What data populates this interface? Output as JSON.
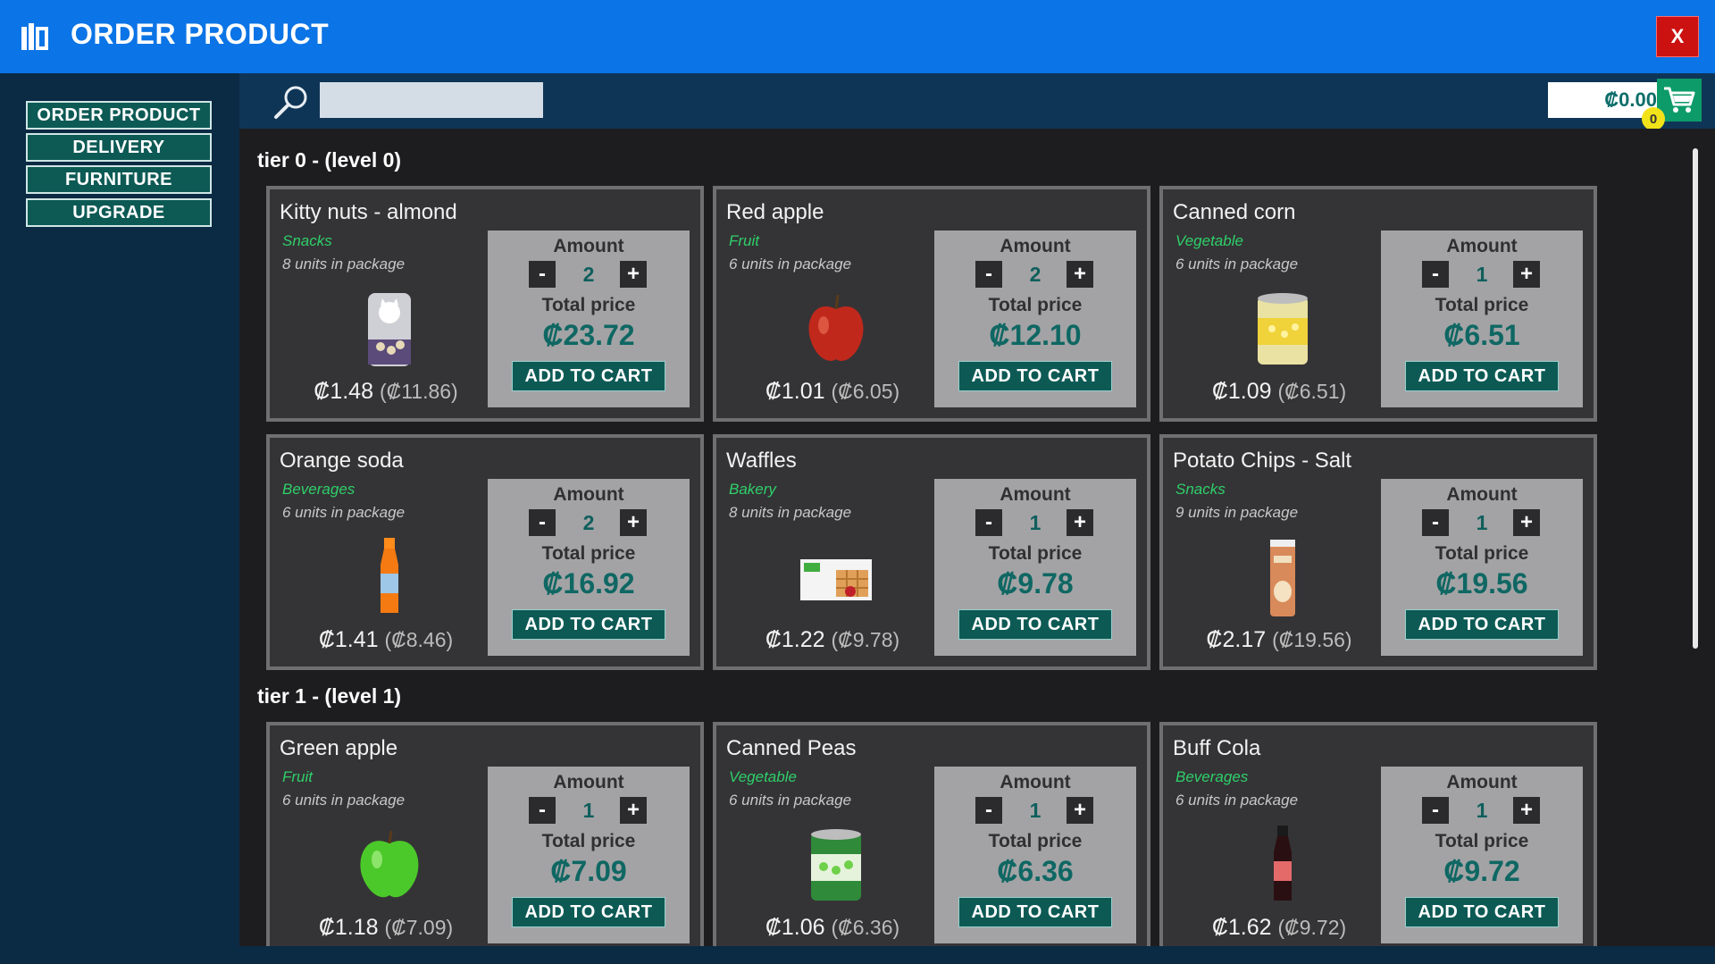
{
  "window": {
    "title": "ORDER PRODUCT",
    "close_label": "X"
  },
  "sidebar": {
    "items": [
      {
        "label": "ORDER PRODUCT"
      },
      {
        "label": "DELIVERY"
      },
      {
        "label": "FURNITURE"
      },
      {
        "label": "UPGRADE"
      }
    ]
  },
  "search": {
    "value": "",
    "placeholder": ""
  },
  "cart": {
    "total": "₡0.00",
    "count": "0"
  },
  "tiers": [
    {
      "title": "tier 0 - (level 0)",
      "products": [
        {
          "name": "Kitty nuts - almond",
          "category": "Snacks",
          "units": "8 units in package",
          "unit_price": "₡1.48",
          "pkg_price": "(₡11.86)",
          "amount": "2",
          "total": "₡23.72",
          "image_icon": "kitty-nuts-product-icon"
        },
        {
          "name": "Red apple",
          "category": "Fruit",
          "units": "6 units in package",
          "unit_price": "₡1.01",
          "pkg_price": "(₡6.05)",
          "amount": "2",
          "total": "₡12.10",
          "image_icon": "red-apple-product-icon"
        },
        {
          "name": "Canned corn",
          "category": "Vegetable",
          "units": "6 units in package",
          "unit_price": "₡1.09",
          "pkg_price": "(₡6.51)",
          "amount": "1",
          "total": "₡6.51",
          "image_icon": "canned-corn-product-icon"
        },
        {
          "name": "Orange soda",
          "category": "Beverages",
          "units": "6 units in package",
          "unit_price": "₡1.41",
          "pkg_price": "(₡8.46)",
          "amount": "2",
          "total": "₡16.92",
          "image_icon": "orange-soda-product-icon"
        },
        {
          "name": "Waffles",
          "category": "Bakery",
          "units": "8 units in package",
          "unit_price": "₡1.22",
          "pkg_price": "(₡9.78)",
          "amount": "1",
          "total": "₡9.78",
          "image_icon": "waffles-product-icon"
        },
        {
          "name": "Potato Chips - Salt",
          "category": "Snacks",
          "units": "9 units in package",
          "unit_price": "₡2.17",
          "pkg_price": "(₡19.56)",
          "amount": "1",
          "total": "₡19.56",
          "image_icon": "potato-chips-product-icon"
        }
      ]
    },
    {
      "title": "tier 1 - (level 1)",
      "products": [
        {
          "name": "Green apple",
          "category": "Fruit",
          "units": "6 units in package",
          "unit_price": "₡1.18",
          "pkg_price": "(₡7.09)",
          "amount": "1",
          "total": "₡7.09",
          "image_icon": "green-apple-product-icon"
        },
        {
          "name": "Canned Peas",
          "category": "Vegetable",
          "units": "6 units in package",
          "unit_price": "₡1.06",
          "pkg_price": "(₡6.36)",
          "amount": "1",
          "total": "₡6.36",
          "image_icon": "canned-peas-product-icon"
        },
        {
          "name": "Buff Cola",
          "category": "Beverages",
          "units": "6 units in package",
          "unit_price": "₡1.62",
          "pkg_price": "(₡9.72)",
          "amount": "1",
          "total": "₡9.72",
          "image_icon": "buff-cola-product-icon"
        }
      ]
    }
  ],
  "labels": {
    "amount": "Amount",
    "total_price": "Total price",
    "add_to_cart": "ADD TO CART",
    "minus": "-",
    "plus": "+"
  },
  "colors": {
    "header": "#0b74e6",
    "accent": "#0d5a55",
    "category": "#2fcf6a",
    "close": "#cc1111",
    "badge": "#f2e21a"
  }
}
